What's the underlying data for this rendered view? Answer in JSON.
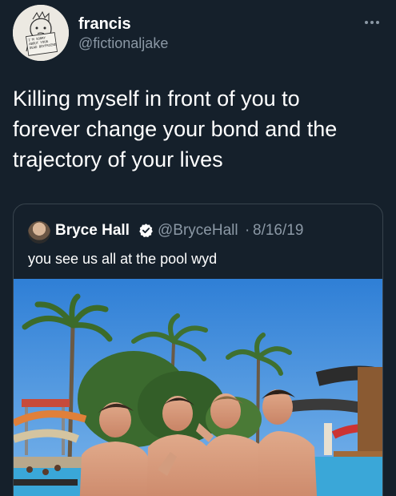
{
  "tweet": {
    "display_name": "francis",
    "handle": "@fictionaljake",
    "more_icon": "more-horizontal-icon",
    "avatar_note": "I'M SORRY ABOUT YOUR DEAD BOYFRIEND",
    "text": "Killing myself in front of you to\nforever change your bond and the\ntrajectory of your lives"
  },
  "quoted": {
    "display_name": "Bryce Hall",
    "verified_icon": "verified-badge-icon",
    "handle": "@BryceHall",
    "separator": "·",
    "date": "8/16/19",
    "text": "you see us all at the pool wyd",
    "photo": "photo of four shirtless young men at a water park pool"
  },
  "colors": {
    "background": "#15202b",
    "border": "#38444d",
    "secondary_text": "#8b98a5",
    "verified": "#ffffff"
  }
}
